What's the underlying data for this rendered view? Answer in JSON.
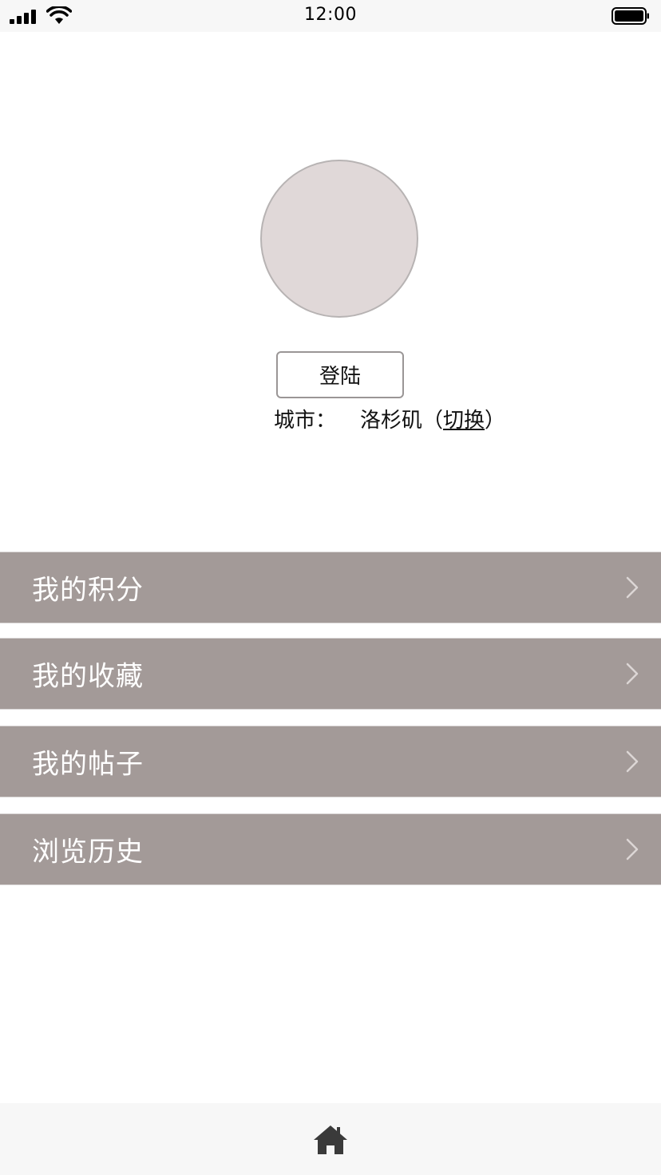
{
  "status_bar": {
    "time": "12:00"
  },
  "profile": {
    "login_label": "登陆",
    "city_label": "城市：",
    "city_value": "洛杉矶（",
    "switch_label": "切换",
    "city_suffix": "）"
  },
  "menu": {
    "items": [
      {
        "label": "我的积分",
        "icon": "chevron-right-icon"
      },
      {
        "label": "我的收藏",
        "icon": "chevron-right-icon"
      },
      {
        "label": "我的帖子",
        "icon": "chevron-right-icon"
      },
      {
        "label": "浏览历史",
        "icon": "chevron-right-icon"
      }
    ]
  },
  "tab_bar": {
    "icon": "home-icon"
  },
  "colors": {
    "menu_background": "#a39a98",
    "avatar_fill": "#e0d8d8",
    "bar_background": "#f7f7f7"
  }
}
